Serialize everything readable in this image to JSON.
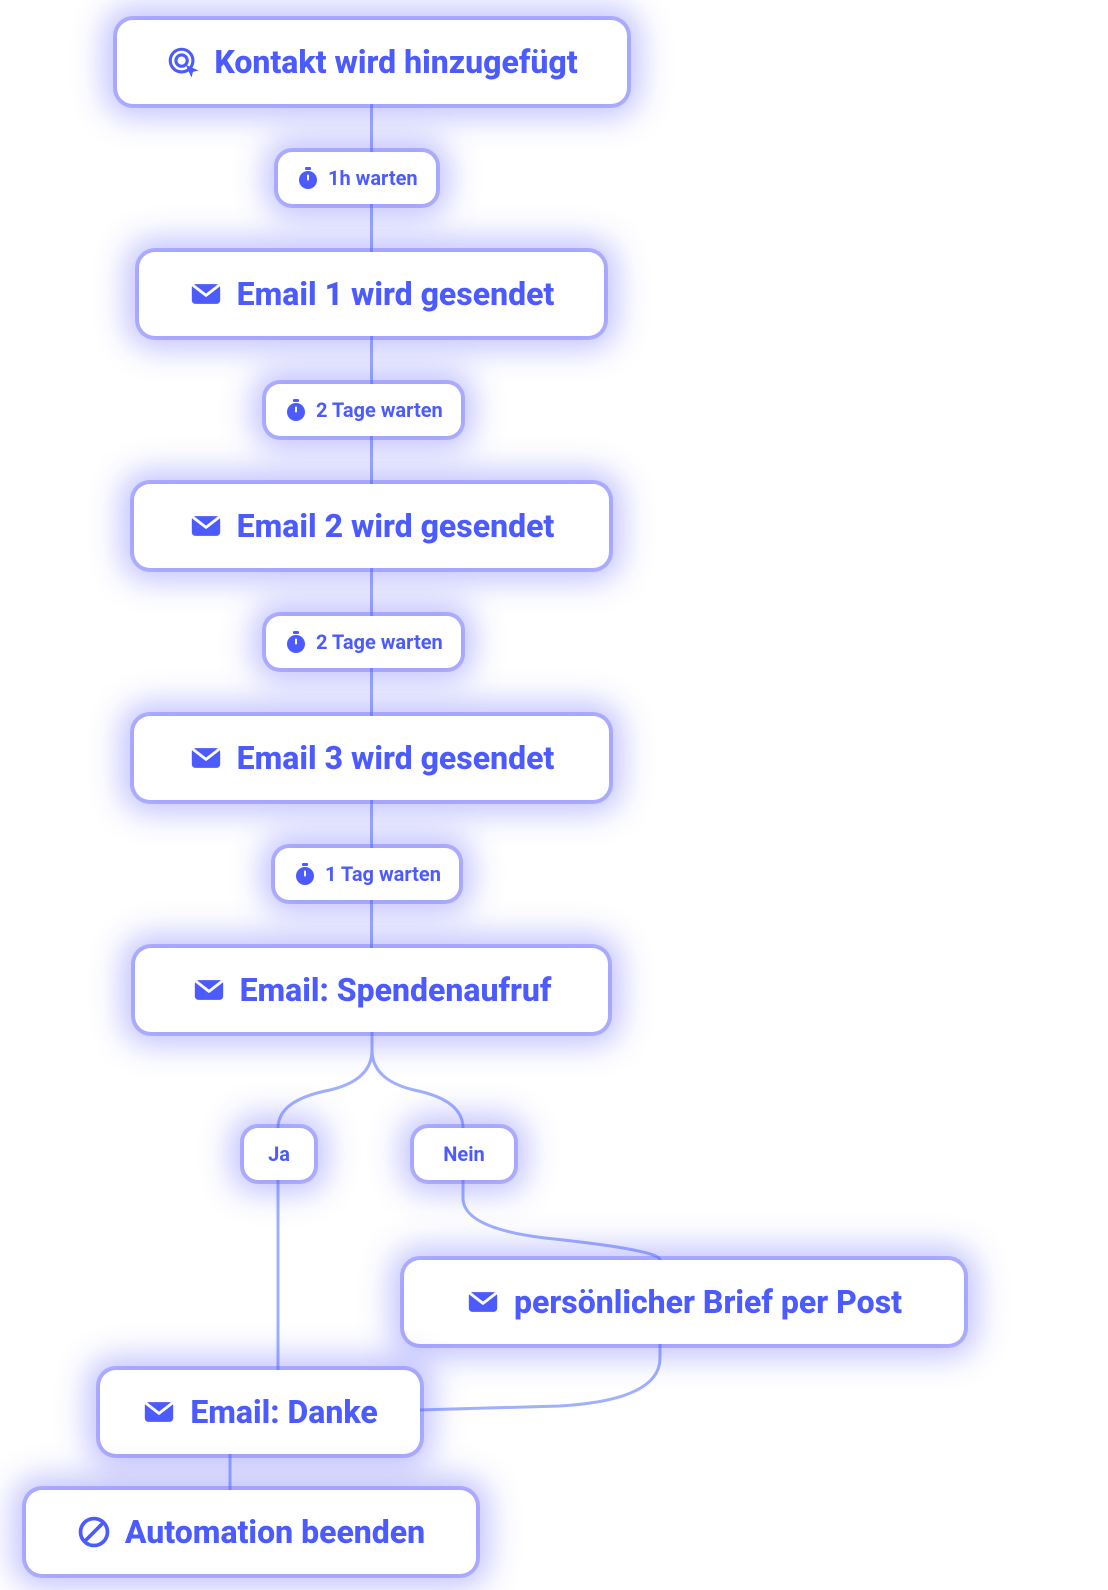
{
  "colors": {
    "primary": "#4b5bff",
    "glow": "rgba(90,90,255,0.6)"
  },
  "nodes": {
    "start": {
      "icon": "click-target-icon",
      "label": "Kontakt wird hinzugefügt"
    },
    "wait1": {
      "icon": "stopwatch-icon",
      "label": "1h  warten"
    },
    "email1": {
      "icon": "envelope-icon",
      "label": "Email 1 wird gesendet"
    },
    "wait2": {
      "icon": "stopwatch-icon",
      "label": "2 Tage warten"
    },
    "email2": {
      "icon": "envelope-icon",
      "label": "Email 2 wird gesendet"
    },
    "wait3": {
      "icon": "stopwatch-icon",
      "label": "2 Tage warten"
    },
    "email3": {
      "icon": "envelope-icon",
      "label": "Email 3 wird gesendet"
    },
    "wait4": {
      "icon": "stopwatch-icon",
      "label": "1 Tag warten"
    },
    "donation": {
      "icon": "envelope-icon",
      "label": "Email: Spendenaufruf"
    },
    "yes": {
      "label": "Ja"
    },
    "no": {
      "label": "Nein"
    },
    "letter": {
      "icon": "envelope-icon",
      "label": "persönlicher Brief per Post"
    },
    "thanks": {
      "icon": "envelope-icon",
      "label": "Email: Danke"
    },
    "end": {
      "icon": "stop-icon",
      "label": "Automation beenden"
    }
  }
}
